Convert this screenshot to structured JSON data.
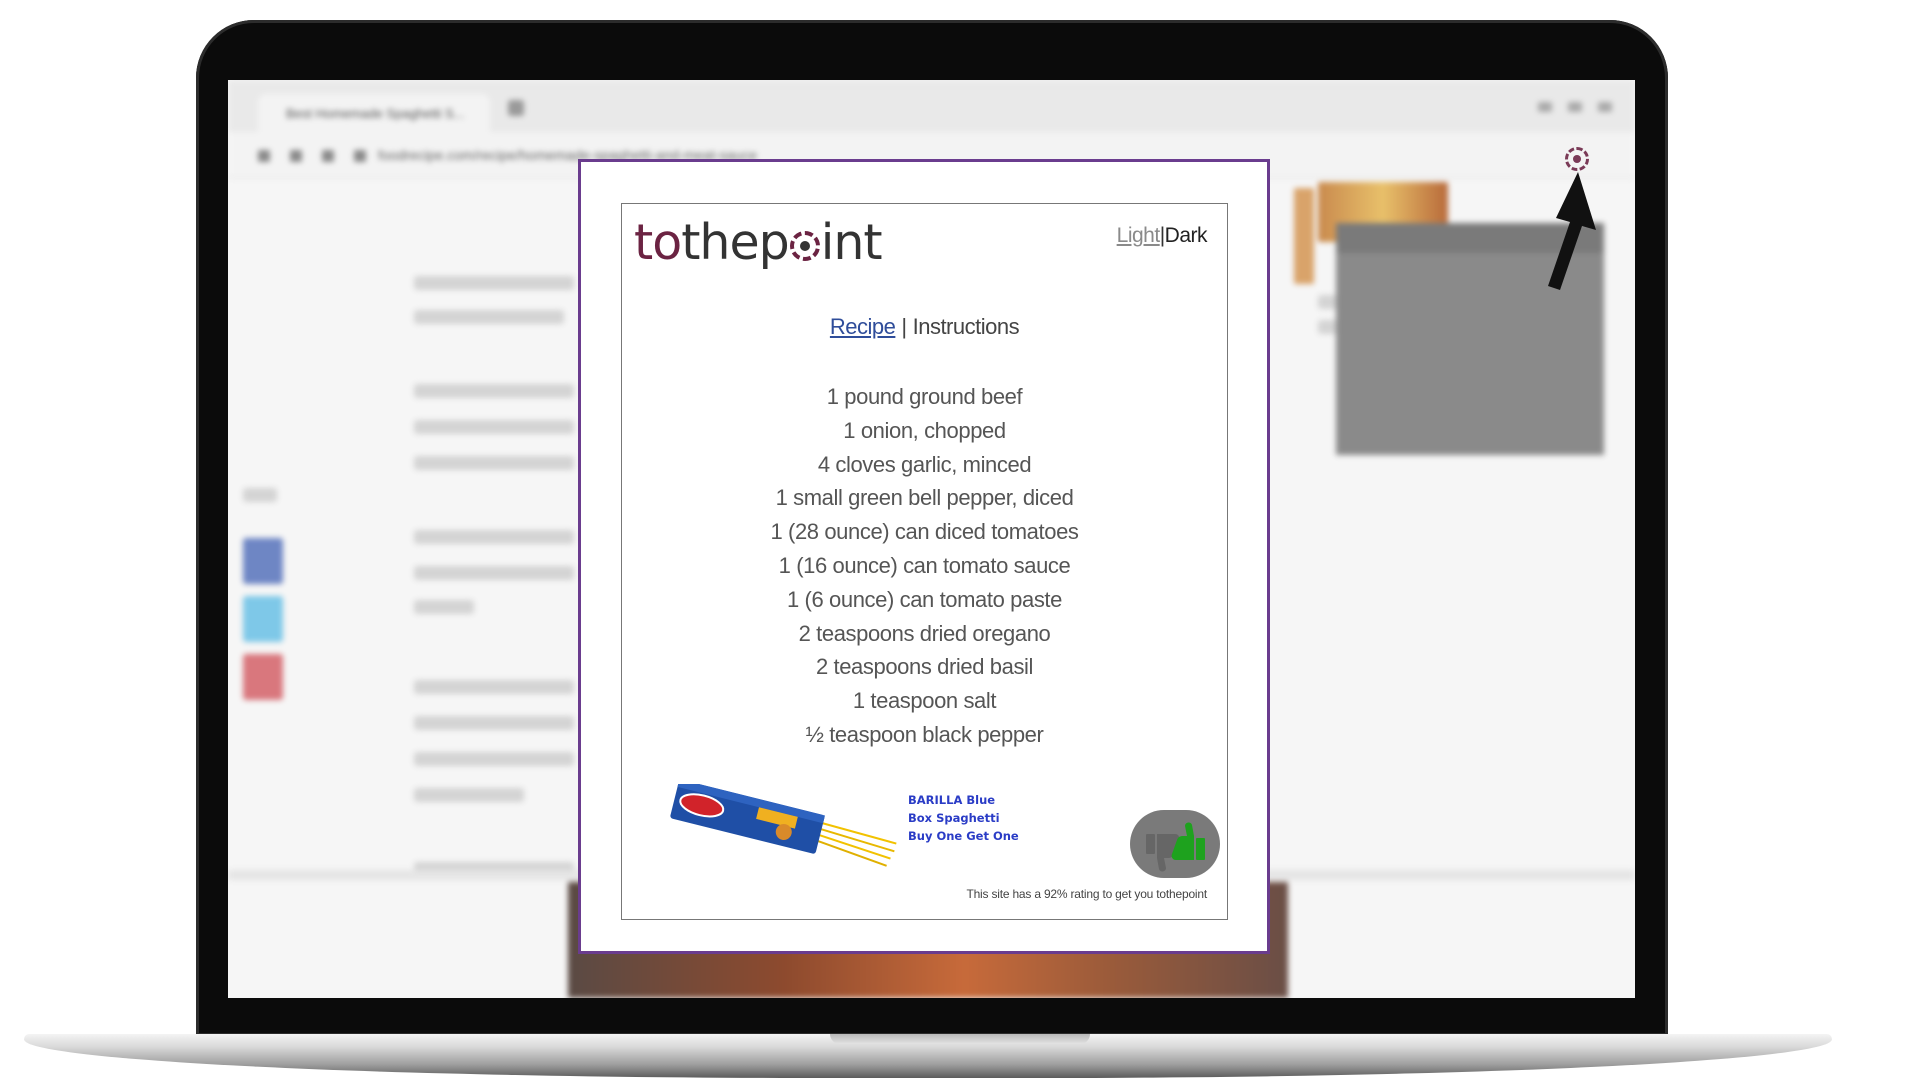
{
  "browser": {
    "tab_title": "Best Homemade Spaghetti S...",
    "url": "foodrecipe.com/recipe/homemade-spaghetti-and-meat-sauce"
  },
  "extension": {
    "icon": "tothepoint-target-icon",
    "accent_color": "#6a3c8e"
  },
  "popup": {
    "logo": {
      "to": "to",
      "the": "the",
      "p": "p",
      "int": "int"
    },
    "theme": {
      "light": "Light",
      "separator": "|",
      "dark": "Dark"
    },
    "tabs": {
      "recipe": "Recipe",
      "separator": "|",
      "instructions": "Instructions"
    },
    "ingredients": [
      "1 pound ground beef",
      "1 onion, chopped",
      "4 cloves garlic, minced",
      "1 small green bell pepper, diced",
      "1 (28 ounce) can diced tomatoes",
      "1 (16 ounce) can tomato sauce",
      "1 (6 ounce) can tomato paste",
      "2 teaspoons dried oregano",
      "2 teaspoons dried basil",
      "1 teaspoon salt",
      "½ teaspoon black pepper"
    ],
    "ad": {
      "line1": "BARILLA Blue",
      "line2": "Box Spaghetti",
      "line3": "Buy One Get One",
      "color": "#2a3cc6"
    },
    "rating_text": "This site has a 92% rating to get you tothepoint"
  }
}
